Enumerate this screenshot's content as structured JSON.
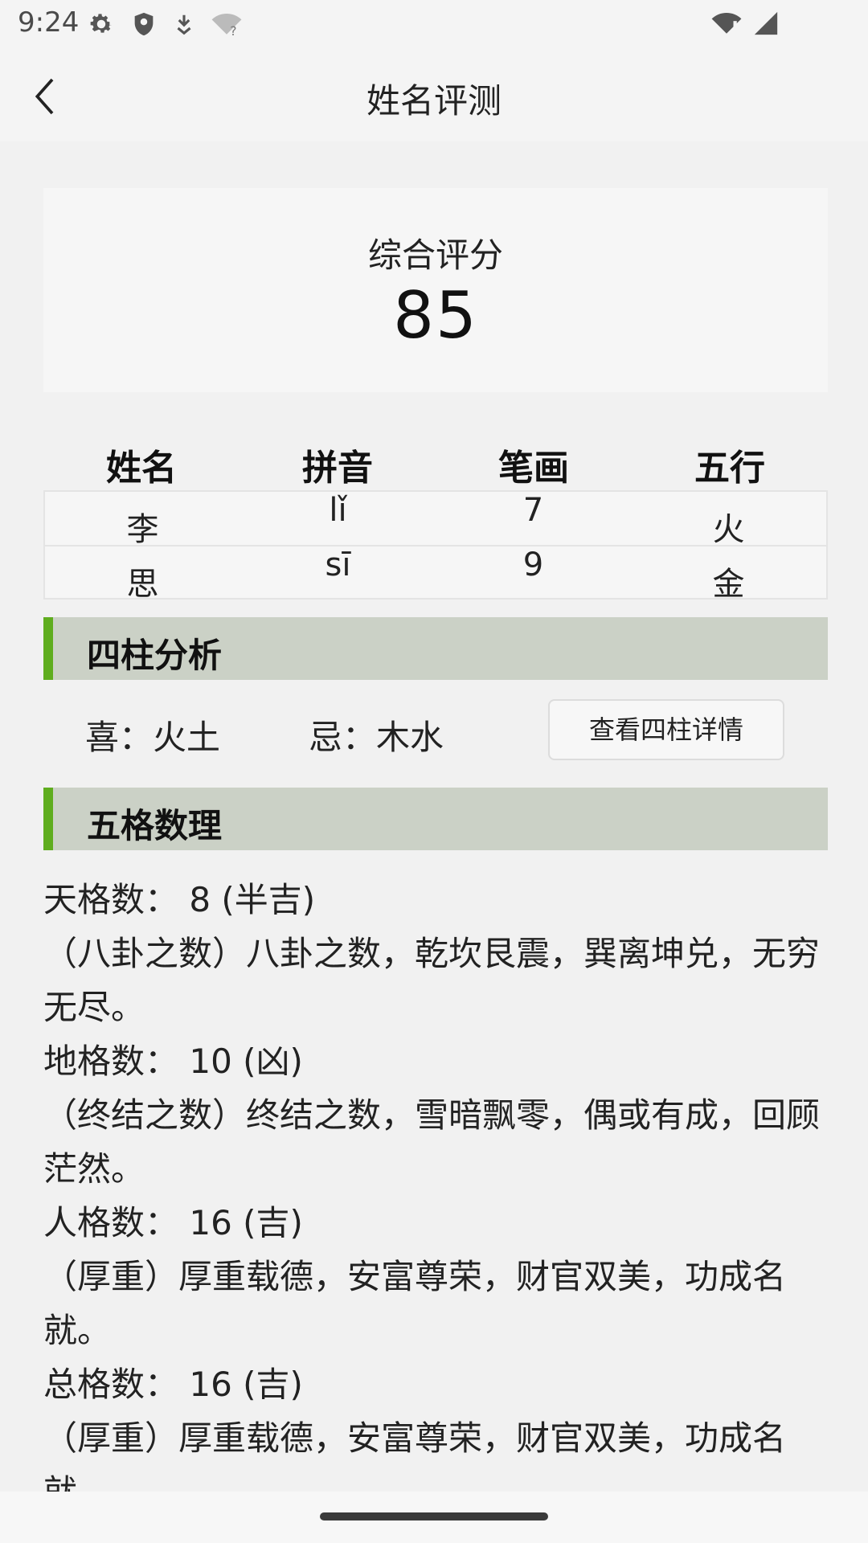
{
  "status": {
    "time": "9:24",
    "icons_left": [
      "gear-icon",
      "shield-icon",
      "download-icon",
      "wifi-question-icon"
    ],
    "icons_right": [
      "wifi-alert-icon",
      "cell-signal-icon"
    ]
  },
  "appbar": {
    "title": "姓名评测",
    "back_icon": "chevron-left-icon"
  },
  "score": {
    "label": "综合评分",
    "value": "85"
  },
  "name_table": {
    "headers": [
      "姓名",
      "拼音",
      "笔画",
      "五行"
    ],
    "rows": [
      {
        "char": "李",
        "pinyin": "lǐ",
        "strokes": "7",
        "wuxing": "火"
      },
      {
        "char": "思",
        "pinyin": "sī",
        "strokes": "9",
        "wuxing": "金"
      }
    ]
  },
  "sizhu": {
    "title": "四柱分析",
    "xi": "喜：火土",
    "ji": "忌：木水",
    "button_label": "查看四柱详情"
  },
  "wuge": {
    "title": "五格数理",
    "items": [
      {
        "title": "天格数： 8 (半吉)",
        "desc": "（八卦之数）八卦之数，乾坎艮震，巽离坤兑，无穷无尽。"
      },
      {
        "title": "地格数： 10 (凶)",
        "desc": "（终结之数）终结之数，雪暗飘零，偶或有成，回顾茫然。"
      },
      {
        "title": "人格数： 16 (吉)",
        "desc": "（厚重）厚重载德，安富尊荣，财官双美，功成名就。"
      },
      {
        "title": "总格数： 16 (吉)",
        "desc": "（厚重）厚重载德，安富尊荣，财官双美，功成名就。"
      }
    ]
  }
}
